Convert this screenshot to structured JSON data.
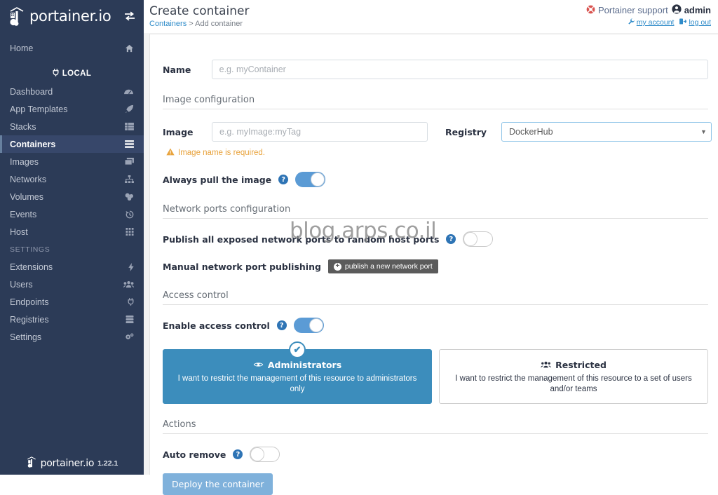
{
  "sidebar": {
    "brand": "portainer.io",
    "toggle_icon": "exchange-arrows-icon",
    "home_label": "Home",
    "endpoint_label": "LOCAL",
    "settings_label": "SETTINGS",
    "items": [
      {
        "label": "Dashboard",
        "icon": "dashboard-icon",
        "active": false
      },
      {
        "label": "App Templates",
        "icon": "rocket-icon",
        "active": false
      },
      {
        "label": "Stacks",
        "icon": "list-icon",
        "active": false
      },
      {
        "label": "Containers",
        "icon": "containers-icon",
        "active": true
      },
      {
        "label": "Images",
        "icon": "images-icon",
        "active": false
      },
      {
        "label": "Networks",
        "icon": "network-icon",
        "active": false
      },
      {
        "label": "Volumes",
        "icon": "volumes-icon",
        "active": false
      },
      {
        "label": "Events",
        "icon": "history-icon",
        "active": false
      },
      {
        "label": "Host",
        "icon": "grid-icon",
        "active": false
      }
    ],
    "settings_items": [
      {
        "label": "Extensions",
        "icon": "bolt-icon"
      },
      {
        "label": "Users",
        "icon": "users-icon"
      },
      {
        "label": "Endpoints",
        "icon": "plug-icon"
      },
      {
        "label": "Registries",
        "icon": "registry-icon"
      },
      {
        "label": "Settings",
        "icon": "gears-icon"
      }
    ],
    "footer_brand": "portainer.io",
    "version": "1.22.1"
  },
  "header": {
    "title": "Create container",
    "breadcrumb_root": "Containers",
    "breadcrumb_sep": ">",
    "breadcrumb_current": "Add container",
    "support_label": "Portainer support",
    "support_icon": "lifebuoy-icon",
    "user_name": "admin",
    "user_icon": "user-circle-icon",
    "my_account_label": "my account",
    "my_account_icon": "wrench-icon",
    "logout_label": "log out",
    "logout_icon": "sign-out-icon"
  },
  "form": {
    "name_label": "Name",
    "name_value": "",
    "name_placeholder": "e.g. myContainer",
    "image_section": "Image configuration",
    "image_label": "Image",
    "image_value": "",
    "image_placeholder": "e.g. myImage:myTag",
    "registry_label": "Registry",
    "registry_value": "DockerHub",
    "registry_options": [
      "DockerHub"
    ],
    "image_error": "Image name is required.",
    "image_error_icon": "warning-triangle-icon",
    "always_pull_label": "Always pull the image",
    "always_pull_on": true,
    "ports_section": "Network ports configuration",
    "publish_all_label": "Publish all exposed network ports to random host ports",
    "publish_all_on": false,
    "manual_ports_label": "Manual network port publishing",
    "publish_port_button": "publish a new network port",
    "publish_port_icon": "plus-circle-icon",
    "access_section": "Access control",
    "enable_access_label": "Enable access control",
    "enable_access_on": true,
    "access_options": [
      {
        "title": "Administrators",
        "icon": "ninja-icon",
        "description": "I want to restrict the management of this resource to administrators only",
        "selected": true
      },
      {
        "title": "Restricted",
        "icon": "users-group-icon",
        "description": "I want to restrict the management of this resource to a set of users and/or teams",
        "selected": false
      }
    ],
    "actions_section": "Actions",
    "auto_remove_label": "Auto remove",
    "auto_remove_on": false,
    "deploy_button": "Deploy the container"
  },
  "watermark": "blog.arps.co.il",
  "colors": {
    "sidebar_bg": "#2c3b57",
    "accent_blue": "#3c8dbc",
    "toggle_on": "#5b9bd5",
    "warning": "#e8a33d",
    "support_red": "#d9534f",
    "link_blue": "#2e8bc9"
  }
}
